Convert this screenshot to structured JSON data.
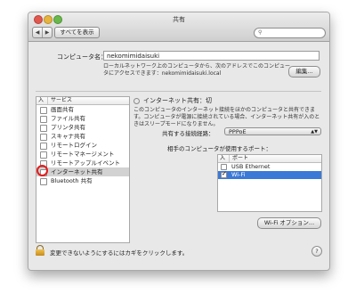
{
  "window": {
    "title": "共有"
  },
  "toolbar": {
    "back_icon": "◀",
    "forward_icon": "▶",
    "show_all_label": "すべてを表示",
    "search_icon": "⚲",
    "search_placeholder": ""
  },
  "computer_name": {
    "label": "コンピュータ名：",
    "value": "nekomimidaisuki",
    "description": "ローカルネットワーク上のコンピュータから、次のアドレスでこのコンピュータにアクセスできます：nekomimidaisuki.local",
    "edit_label": "編集..."
  },
  "services": {
    "header_on": "入",
    "header_service": "サービス",
    "items": [
      {
        "label": "画面共有",
        "checked": false
      },
      {
        "label": "ファイル共有",
        "checked": false
      },
      {
        "label": "プリンタ共有",
        "checked": false
      },
      {
        "label": "スキャナ共有",
        "checked": false
      },
      {
        "label": "リモートログイン",
        "checked": false
      },
      {
        "label": "リモートマネージメント",
        "checked": false
      },
      {
        "label": "リモートアップルイベント",
        "checked": false
      },
      {
        "label": "インターネット共有",
        "checked": false,
        "selected": true
      },
      {
        "label": "Bluetooth 共有",
        "checked": false
      }
    ]
  },
  "detail": {
    "status": "インターネット共有：切",
    "description": "このコンピュータのインターネット接続をほかのコンピュータと共有できます。コンピュータが電源に接続されている場合、インターネット共有が入のときはスリープモードになりません。",
    "connection_label": "共有する接続経路：",
    "connection_value": "PPPoE",
    "ports_label": "相手のコンピュータが使用するポート：",
    "ports_header_on": "入",
    "ports_header_port": "ポート",
    "ports": [
      {
        "label": "USB Ethernet",
        "checked": false
      },
      {
        "label": "Wi-Fi",
        "checked": true,
        "selected": true
      }
    ],
    "wifi_options_label": "Wi-Fi オプション..."
  },
  "footer": {
    "lock_text": "変更できないようにするにはカギをクリックします。",
    "help_label": "?"
  },
  "colors": {
    "selection": "#3b79d7",
    "highlight_circle": "#e51b1b"
  }
}
